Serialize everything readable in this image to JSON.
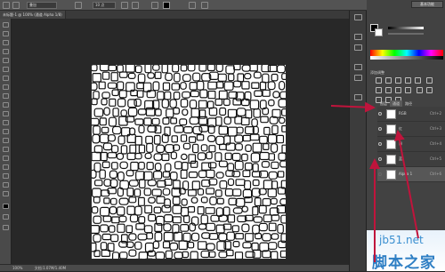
{
  "options_bar": {
    "mode_value": "叠加",
    "size_value": "10 点"
  },
  "document": {
    "tab_label": "未标题-1 @ 100% (通道 Alpha 1/8)"
  },
  "panels": {
    "top_button": "基本功能",
    "adjustments_title": "添加调整",
    "layer_tabs": [
      "图层",
      "通道",
      "路径"
    ]
  },
  "channels": [
    {
      "name": "RGB",
      "shortcut": "Ctrl+2",
      "visible": true
    },
    {
      "name": "红",
      "shortcut": "Ctrl+3",
      "visible": true
    },
    {
      "name": "绿",
      "shortcut": "Ctrl+4",
      "visible": true
    },
    {
      "name": "蓝",
      "shortcut": "Ctrl+5",
      "visible": true
    },
    {
      "name": "Alpha 1",
      "shortcut": "Ctrl+6",
      "visible": false,
      "selected": true
    }
  ],
  "status": {
    "zoom": "100%",
    "doc_info": "文档:1.07M/1.40M"
  },
  "watermark": {
    "site": "jb51.net",
    "brand": "脚本之家"
  },
  "colors": {
    "arrow": "#c0143c",
    "watermark_blue": "#2f7fc4"
  }
}
